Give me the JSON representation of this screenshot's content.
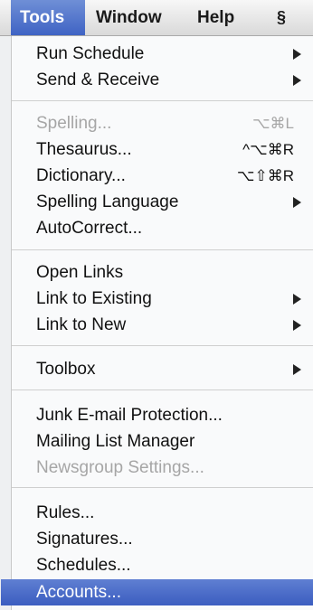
{
  "menubar": {
    "tools": "Tools",
    "window": "Window",
    "help": "Help",
    "script_icon": "§"
  },
  "menu": {
    "run_schedule": "Run Schedule",
    "send_receive": "Send & Receive",
    "spelling": {
      "label": "Spelling...",
      "shortcut": "⌥⌘L"
    },
    "thesaurus": {
      "label": "Thesaurus...",
      "shortcut": "^⌥⌘R"
    },
    "dictionary": {
      "label": "Dictionary...",
      "shortcut": "⌥⇧⌘R"
    },
    "spelling_language": "Spelling Language",
    "autocorrect": "AutoCorrect...",
    "open_links": "Open Links",
    "link_to_existing": "Link to Existing",
    "link_to_new": "Link to New",
    "toolbox": "Toolbox",
    "junk_email": "Junk E-mail Protection...",
    "mailing_list": "Mailing List Manager",
    "newsgroup": "Newsgroup Settings...",
    "rules": "Rules...",
    "signatures": "Signatures...",
    "schedules": "Schedules...",
    "accounts": "Accounts..."
  },
  "colors": {
    "highlight": "#4a6dca",
    "disabled_text": "#a6a6a6"
  }
}
